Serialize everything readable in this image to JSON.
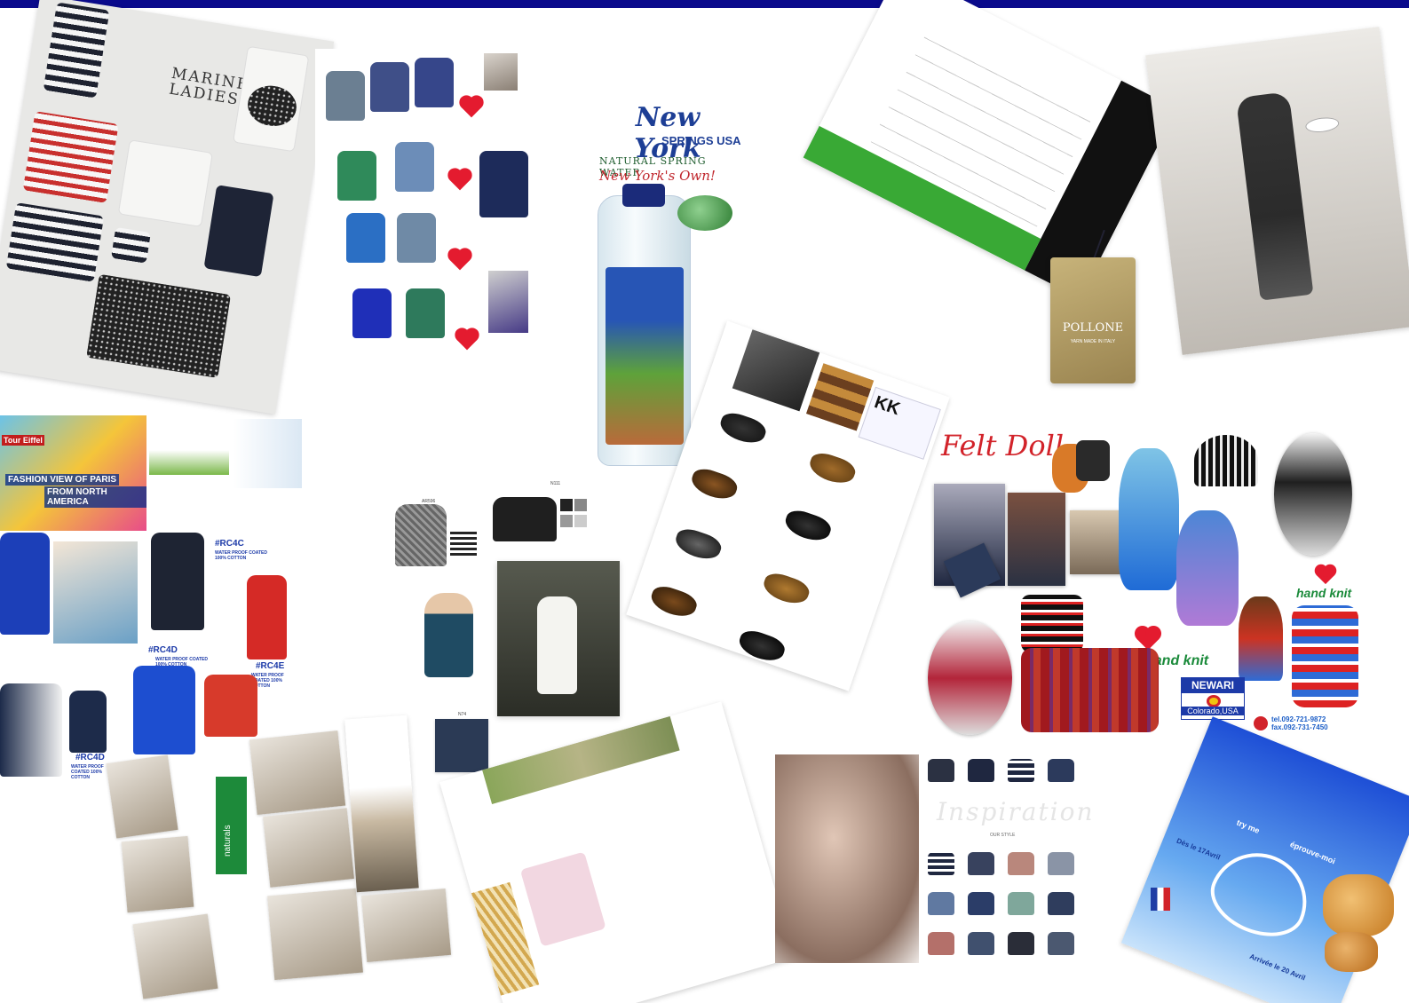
{
  "marine": {
    "title_line1": "MARINE",
    "title_line2": "LADIES"
  },
  "water": {
    "brand_top": "New York",
    "springs": "SPRINGS USA",
    "natural": "NATURAL SPRING WATER",
    "tagline": "New York's Own!"
  },
  "pollone": {
    "name": "POLLONE",
    "sub": "YARN MADE IN ITALY"
  },
  "fashion": {
    "eiffel": "Tour Eiffel",
    "line1": "FASHION VIEW OF PARIS",
    "line2": "FROM NORTH AMERICA"
  },
  "coats": {
    "rc4c": "#RC4C",
    "rc4c_sub": "WATER PROOF COATED 100% COTTON",
    "rc4d": "#RC4D",
    "rc4d_sub": "WATER PROOF COATED 100% COTTON",
    "rc4e": "#RC4E",
    "rc4e_sub": "WATER PROOF COATED 100% COTTON",
    "rc4d2": "#RC4D",
    "rc4d2_sub": "WATER PROOF COATED 100% COTTON"
  },
  "dresses": {
    "code1": "AR596",
    "code2": "N111",
    "code3": "N74"
  },
  "felt": {
    "title": "Felt Doll",
    "handknit1": "hand knit",
    "handknit2": "hand knit",
    "newari": "NEWARI",
    "colorado": "Colorado,USA",
    "tel": "tel.092-721-9872",
    "fax": "fax.092-731-7450"
  },
  "naturals": {
    "label": "naturals"
  },
  "insp": {
    "word": "Inspiration",
    "ours": "OUR STYLE"
  },
  "trime": {
    "dates1": "Dès le 17Avril",
    "dates2": "Arrivée le 20 Avril",
    "tryme": "try me",
    "eprouvez": "éprouve-moi"
  },
  "colors": {
    "topbar": "#0a0a8c",
    "heart": "#e41b2f",
    "felt_red": "#d2232a",
    "knit_green": "#1a8a3a",
    "rc_blue": "#1c3aa8"
  }
}
